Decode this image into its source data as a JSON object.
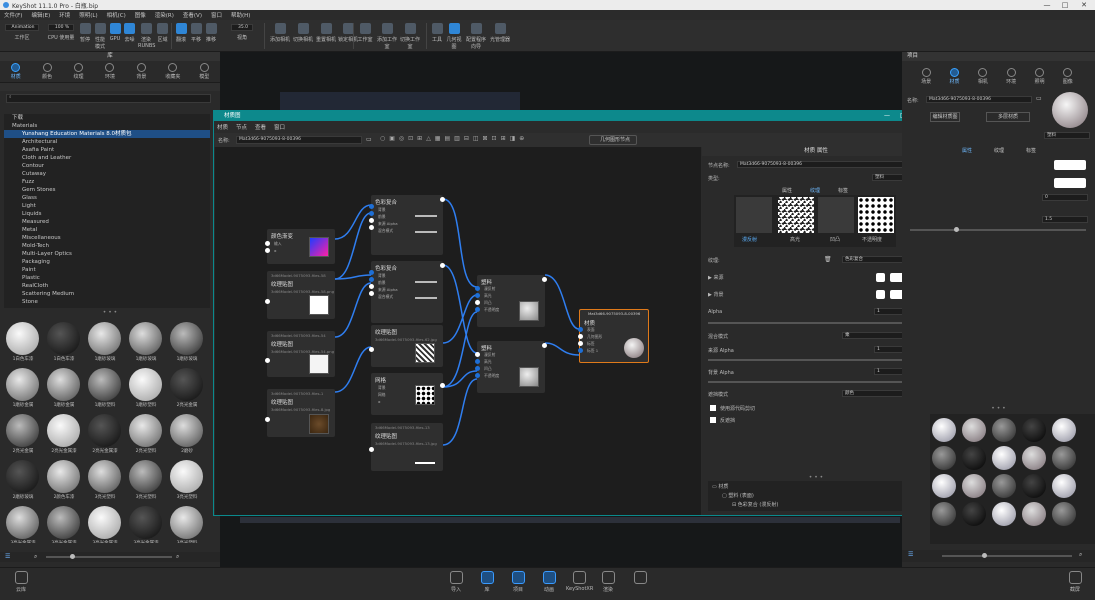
{
  "window": {
    "title": "KeyShot 11.1.0 Pro - 白瓶.bip",
    "min": "—",
    "max": "□",
    "close": "✕"
  },
  "menu": [
    "文件(F)",
    "编辑(E)",
    "环境",
    "照明(L)",
    "相机(C)",
    "图像",
    "渲染(R)",
    "查看(V)",
    "窗口",
    "帮助(H)"
  ],
  "toolbar": {
    "workspace_value": "Animation",
    "zoom_value": "100 %",
    "fov_value": "35.0",
    "items": [
      "工作区",
      "CPU 使用量",
      "暂停",
      "性能模式",
      "GPU",
      "去噪",
      "渲染 RUNBS",
      "区域",
      "翻滚",
      "平移",
      "推移",
      "视角",
      "添加相机",
      "切换相机",
      "重置相机",
      "锁定相机",
      "工作室",
      "添加工作室",
      "切换工作室",
      "工具",
      "几何视图",
      "配置程序向导",
      "光管理器"
    ]
  },
  "library": {
    "title": "库",
    "tabs": [
      "材质",
      "颜色",
      "纹理",
      "环境",
      "背景",
      "收藏夹",
      "模型"
    ],
    "search_placeholder": "",
    "tree": [
      "下载",
      "Materials",
      "Yunshang Education Materials 8.0材质包",
      "Architectural",
      "Asafia Paint",
      "Cloth and Leather",
      "Contour",
      "Cutaway",
      "Fuzz",
      "Gem Stones",
      "Glass",
      "Light",
      "Liquids",
      "Measured",
      "Metal",
      "Miscellaneous",
      "Mold-Tech",
      "Multi-Layer Optics",
      "Packaging",
      "Paint",
      "Plastic",
      "RealCloth",
      "Scattering Medium",
      "Stone"
    ],
    "swatches": [
      "1白色车漆",
      "1白色车漆",
      "1磨砂玻璃",
      "1磨砂玻璃",
      "1磨砂玻璃",
      "1磨砂金属",
      "1磨砂金属",
      "1磨砂塑料",
      "1磨砂塑料",
      "2亮光金属",
      "2亮光金属",
      "2亮光金属漆",
      "2亮光金属漆",
      "2亮光塑料",
      "2磨砂",
      "2磨砂玻璃",
      "2颜色车漆",
      "3亮光塑料",
      "3亮光塑料",
      "3亮光塑料",
      "3亮光金属漆",
      "3亮光金属漆",
      "3亮光金属漆",
      "3亮光金属漆",
      "3亮光塑料"
    ]
  },
  "material_window": {
    "title": "材质图",
    "menu": [
      "材质",
      "节点",
      "查看",
      "窗口"
    ],
    "name_label": "名称:",
    "name_value": "Mat3d66-9075093-8-00396",
    "fit_button": "几何图形节点",
    "nodes": {
      "gradient": {
        "title": "颜色渐变",
        "ports": [
          "输入",
          "α"
        ]
      },
      "blend1": {
        "title": "色彩复合",
        "ports": [
          "背景",
          "前景",
          "来源 Alpha",
          "混合模式"
        ]
      },
      "blend2": {
        "title": "色彩复合",
        "ports": [
          "背景",
          "前景",
          "来源 Alpha",
          "混合模式"
        ]
      },
      "tex1": {
        "sub": "3d66Model-9075093-files-58",
        "title": "纹理贴图",
        "file": "3d66Model-9075093-files-58.png"
      },
      "tex2": {
        "sub": "3d66Model-9075093-files-54",
        "title": "纹理贴图",
        "file": "3d66Model-9075093-files-54.png"
      },
      "tex3": {
        "sub": "3d66Model-9075093-files-1",
        "title": "纹理贴图",
        "file": "3d66Model-9075093-files-8.jpg"
      },
      "tex4": {
        "title": "纹理贴图",
        "file": "3d66Model-9075093-files-62.jpg"
      },
      "mesh": {
        "title": "网格",
        "ports": [
          "背景",
          "网格",
          "α"
        ]
      },
      "tex5": {
        "sub": "3d66Model-9075093-files-13",
        "title": "纹理贴图",
        "file": "3d66Model-9075093-files-13.jpg"
      },
      "plastic1": {
        "title": "塑料",
        "ports": [
          "漫反射",
          "高光",
          "凹凸",
          "不透明度"
        ]
      },
      "plastic2": {
        "title": "塑料",
        "ports": [
          "漫反射",
          "高光",
          "凹凸",
          "不透明度"
        ]
      },
      "mat": {
        "header": "Mat3d66-9075093-8-00396",
        "title": "材质",
        "ports": [
          "表面",
          "几何图形",
          "标签",
          "标签 1"
        ]
      }
    }
  },
  "properties": {
    "title": "材质 属性",
    "node_name_label": "节点名称:",
    "node_name_value": "Mat3d66-9075093-8-00396",
    "type_label": "类型:",
    "type_value": "塑料",
    "tabs": [
      "属性",
      "纹理",
      "标签"
    ],
    "tex_slots": [
      "漫反射",
      "高光",
      "凹凸",
      "不透明度"
    ],
    "texture_label": "纹理:",
    "texture_value": "色彩复合",
    "source": "来源",
    "background": "背景",
    "alpha_label": "Alpha",
    "alpha_value": "1",
    "mix_mode_label": "混合模式",
    "mix_mode_value": "乘",
    "src_alpha": "来源 Alpha",
    "src_alpha_value": "1",
    "bg_alpha": "背景 Alpha",
    "bg_alpha_value": "1",
    "clip_label": "遮挡模式",
    "clip_value": "颜色",
    "cb1": "使用源代码剪切",
    "cb2": "反遮挡",
    "tree": [
      "材质",
      "塑料 (表面)",
      "色彩复合 (漫反射)"
    ]
  },
  "project": {
    "title": "项目",
    "tabs": [
      "场景",
      "材质",
      "相机",
      "环境",
      "照明",
      "图像"
    ],
    "name_label": "名称:",
    "name_value": "Mat3d66-9075093-8-00396",
    "btn1": "编辑材质图",
    "btn2": "多层材质",
    "type_value": "塑料",
    "sub_tabs": [
      "属性",
      "纹理",
      "标签"
    ],
    "val1": "0",
    "val2": "1.5"
  },
  "bottombar": [
    "导入",
    "库",
    "项目",
    "动画",
    "KeyShotXR",
    "渲染",
    "截屏"
  ],
  "statusbar": [
    "云库"
  ],
  "warning": "⚠"
}
